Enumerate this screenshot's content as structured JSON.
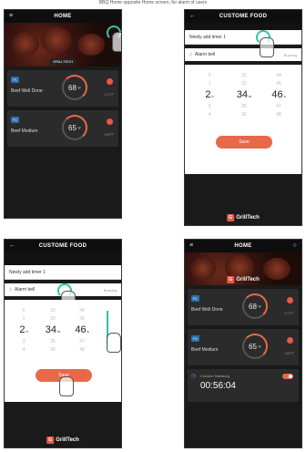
{
  "caption": "BBQ Home opposite Home screen, for alarm of users",
  "screen1": {
    "title": "HOME",
    "menu_icon": "≡",
    "hero_label": "GRILLTECH",
    "probes": [
      {
        "tag": "P1",
        "name": "Beef Well Done",
        "temp": "68",
        "unit": "°F",
        "set": "170°F"
      },
      {
        "tag": "P2",
        "name": "Beef Medium",
        "temp": "65",
        "unit": "°F",
        "set": "155°F"
      }
    ]
  },
  "screen2": {
    "title": "CUSTOME FOOD",
    "back_icon": "←",
    "timer_name": "Newly add timer 1",
    "alarm_label": "Alarm bell",
    "alarm_value": "Buzzing",
    "picker": {
      "hours": [
        "0",
        "1",
        "2",
        "3",
        "4"
      ],
      "minutes": [
        "32",
        "33",
        "34",
        "35",
        "36"
      ],
      "seconds": [
        "44",
        "45",
        "46",
        "47",
        "48"
      ],
      "sel_h": "2",
      "sel_m": "34",
      "sel_s": "46",
      "unit_h": "h",
      "unit_m": "m",
      "unit_s": "s"
    },
    "save_label": "Save",
    "brand": "GrillTech"
  },
  "screen3": {
    "title": "CUSTOME FOOD",
    "timer_name": "Newly add timer 1",
    "alarm_label": "Alarm bell",
    "alarm_value": "Buzzing",
    "save_label": "Save",
    "brand": "GrillTech"
  },
  "screen4": {
    "title": "HOME",
    "brand": "GrillTech",
    "probes": [
      {
        "tag": "P1",
        "name": "Beef Well Done",
        "temp": "68",
        "unit": "°F",
        "set": "170°F"
      },
      {
        "tag": "P2",
        "name": "Beef Medium",
        "temp": "65",
        "unit": "°F",
        "set": "155°F"
      }
    ],
    "timer": {
      "name": "Chicken Hamburg",
      "time": "00:56:04"
    }
  },
  "colors": {
    "accent": "#e8694a",
    "teal": "#2ec4a6",
    "probe_tag": "#2b6fb0"
  }
}
